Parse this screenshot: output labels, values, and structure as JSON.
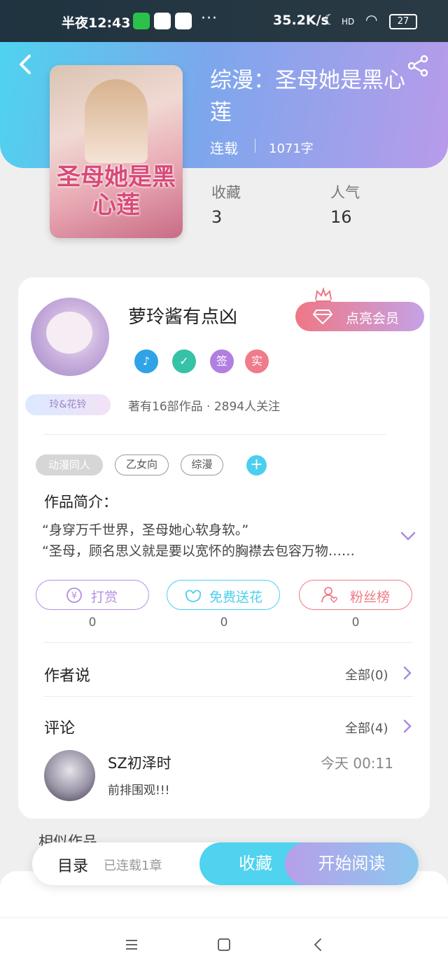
{
  "status_bar": {
    "time": "半夜12:43",
    "more": "···",
    "net_speed": "35.2K/s",
    "signal_label": "HD",
    "battery": "27"
  },
  "book": {
    "title": "综漫：圣母她是黑心莲",
    "cover_art_text": "圣母她是黑心莲",
    "status": "连载",
    "word_count": "1071字"
  },
  "stats": [
    {
      "label": "收藏",
      "value": "3"
    },
    {
      "label": "人气",
      "value": "16"
    }
  ],
  "author": {
    "name": "萝玲酱有点凶",
    "avatar_badge": "玲&花铃",
    "vip_button": "点亮会员",
    "badges": [
      {
        "text": "♪",
        "color": "#2fa3e6"
      },
      {
        "text": "✓",
        "color": "#36c2a6"
      },
      {
        "text": "签",
        "color": "#b07fe0"
      },
      {
        "text": "实",
        "color": "#f07b8a"
      }
    ],
    "meta": "著有16部作品 · 2894人关注"
  },
  "tags": [
    "动漫同人",
    "乙女向",
    "综漫"
  ],
  "intro": {
    "title": "作品简介：",
    "lines": [
      "“身穿万千世界，圣母她心软身软。”",
      "“圣母，顾名思义就是要以宽怀的胸襟去包容万物……"
    ]
  },
  "actions": [
    {
      "label": "打赏",
      "count": "0",
      "color": "#b48fe3"
    },
    {
      "label": "免费送花",
      "count": "0",
      "color": "#4ccfee"
    },
    {
      "label": "粉丝榜",
      "count": "0",
      "color": "#ee7b85"
    }
  ],
  "author_says": {
    "title": "作者说",
    "more": "全部(0)"
  },
  "comments": {
    "title": "评论",
    "more": "全部(4)",
    "items": [
      {
        "name": "SZ初泽时",
        "time": "今天 00:11",
        "text": "前排围观!!!"
      }
    ]
  },
  "similar_title": "相似作品",
  "bottom_bar": {
    "catalog": "目录",
    "chapters": "已连载1章",
    "favorite": "收藏",
    "read": "开始阅读"
  },
  "colors": {
    "accent_cyan": "#4fd3ef",
    "accent_purple": "#b89bea",
    "vip_pink": "#ef7785"
  }
}
